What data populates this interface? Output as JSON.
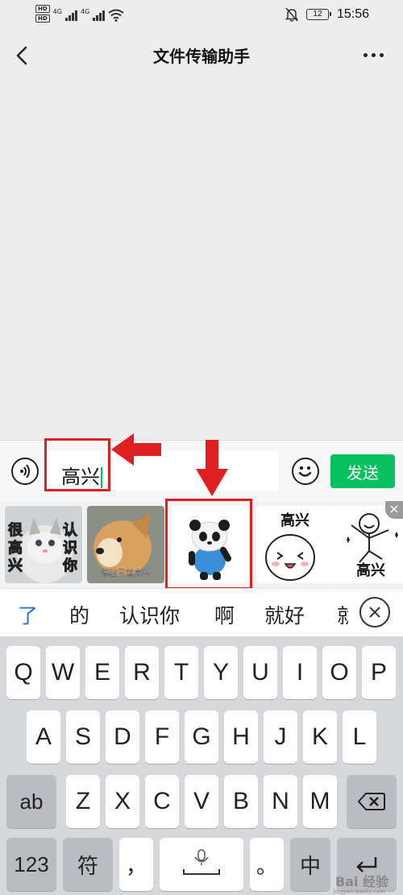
{
  "status_bar": {
    "hd_1": "HD",
    "hd_2": "HD",
    "net_1": "4G",
    "net_2": "4G",
    "battery": "12",
    "time": "15:56",
    "icons": [
      "wifi-icon",
      "mute-bell-icon",
      "battery-icon"
    ]
  },
  "nav": {
    "title": "文件传输助手",
    "back_icon": "chevron-left-icon",
    "more_icon": "more-dots-icon"
  },
  "input_bar": {
    "value": "高兴",
    "send_label": "发送",
    "voice_icon": "voice-icon",
    "emoji_icon": "emoji-icon"
  },
  "stickers": [
    {
      "name": "cat-sticker",
      "caption_left": "很高兴",
      "caption_right": "认识你"
    },
    {
      "name": "dog-sticker",
      "caption": "满脸写着高兴"
    },
    {
      "name": "panda-sticker"
    },
    {
      "name": "face-sticker",
      "caption": "高兴"
    },
    {
      "name": "dancing-figure-sticker",
      "caption": "高兴"
    }
  ],
  "candidates": [
    "了",
    "的",
    "认识你",
    "啊",
    "就好",
    "就"
  ],
  "keyboard": {
    "row1": [
      "Q",
      "W",
      "E",
      "R",
      "T",
      "Y",
      "U",
      "I",
      "O",
      "P"
    ],
    "row2": [
      "A",
      "S",
      "D",
      "F",
      "G",
      "H",
      "J",
      "K",
      "L"
    ],
    "row3": [
      "ab",
      "Z",
      "X",
      "C",
      "V",
      "B",
      "N",
      "M"
    ],
    "row4": [
      "123",
      "符",
      "，",
      "。",
      "中"
    ]
  },
  "watermark": {
    "text": "Bai 经验",
    "sub": "jingyan.baidu.com"
  },
  "colors": {
    "accent_green": "#07c160",
    "annotation_red": "#e02020",
    "candidate_blue": "#2c6fd6"
  }
}
